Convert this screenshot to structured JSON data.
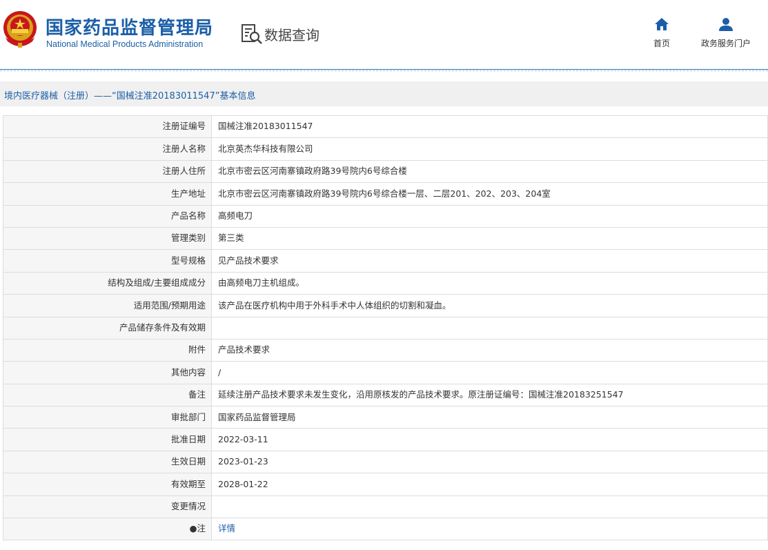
{
  "header": {
    "brand_cn": "国家药品监督管理局",
    "brand_en": "National Medical Products Administration",
    "query_label": "数据查询",
    "nav": [
      {
        "label": "首页",
        "icon": "home-icon"
      },
      {
        "label": "政务服务门户",
        "icon": "user-icon"
      }
    ]
  },
  "breadcrumb": {
    "text": "境内医疗器械（注册）——“国械注准20183011547”基本信息"
  },
  "colors": {
    "brand_blue": "#1b5ea8",
    "label_bg": "#f6f6f6",
    "border": "#dcdcdc"
  },
  "rows": [
    {
      "label": "注册证编号",
      "value": "国械注准20183011547"
    },
    {
      "label": "注册人名称",
      "value": "北京英杰华科技有限公司"
    },
    {
      "label": "注册人住所",
      "value": "北京市密云区河南寨镇政府路39号院内6号综合楼"
    },
    {
      "label": "生产地址",
      "value": "北京市密云区河南寨镇政府路39号院内6号综合楼一层、二层201、202、203、204室"
    },
    {
      "label": "产品名称",
      "value": "高频电刀"
    },
    {
      "label": "管理类别",
      "value": "第三类"
    },
    {
      "label": "型号规格",
      "value": "见产品技术要求"
    },
    {
      "label": "结构及组成/主要组成成分",
      "value": "由高频电刀主机组成。"
    },
    {
      "label": "适用范围/预期用途",
      "value": "该产品在医疗机构中用于外科手术中人体组织的切割和凝血。"
    },
    {
      "label": "产品储存条件及有效期",
      "value": ""
    },
    {
      "label": "附件",
      "value": "产品技术要求"
    },
    {
      "label": "其他内容",
      "value": "/"
    },
    {
      "label": "备注",
      "value": "延续注册产品技术要求未发生变化，沿用原核发的产品技术要求。原注册证编号：国械注准20183251547"
    },
    {
      "label": "审批部门",
      "value": "国家药品监督管理局"
    },
    {
      "label": "批准日期",
      "value": "2022-03-11"
    },
    {
      "label": "生效日期",
      "value": "2023-01-23"
    },
    {
      "label": "有效期至",
      "value": "2028-01-22"
    },
    {
      "label": "变更情况",
      "value": ""
    },
    {
      "label": "●注",
      "value": "详情",
      "is_link": true
    }
  ]
}
